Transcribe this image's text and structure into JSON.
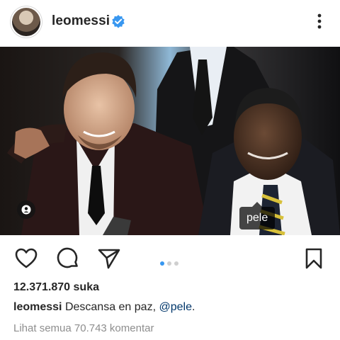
{
  "post": {
    "username": "leomessi",
    "verified": true,
    "photo_tag": "pele",
    "carousel": {
      "count": 3,
      "active_index": 0
    },
    "likes": "12.371.870 suka",
    "caption": {
      "username": "leomessi",
      "text": "Descansa en paz,",
      "mention": "@pele",
      "end": "."
    },
    "view_comments": "Lihat semua 70.743 komentar"
  },
  "icons": {
    "verified": "verified-badge-icon",
    "more": "more-vertical-icon",
    "people": "person-tag-icon",
    "like": "heart-icon",
    "comment": "comment-icon",
    "share": "send-icon",
    "save": "bookmark-icon"
  },
  "colors": {
    "verified": "#3897f0",
    "active_dot": "#3897f0",
    "mention": "#00376b",
    "muted": "#8e8e8e"
  }
}
